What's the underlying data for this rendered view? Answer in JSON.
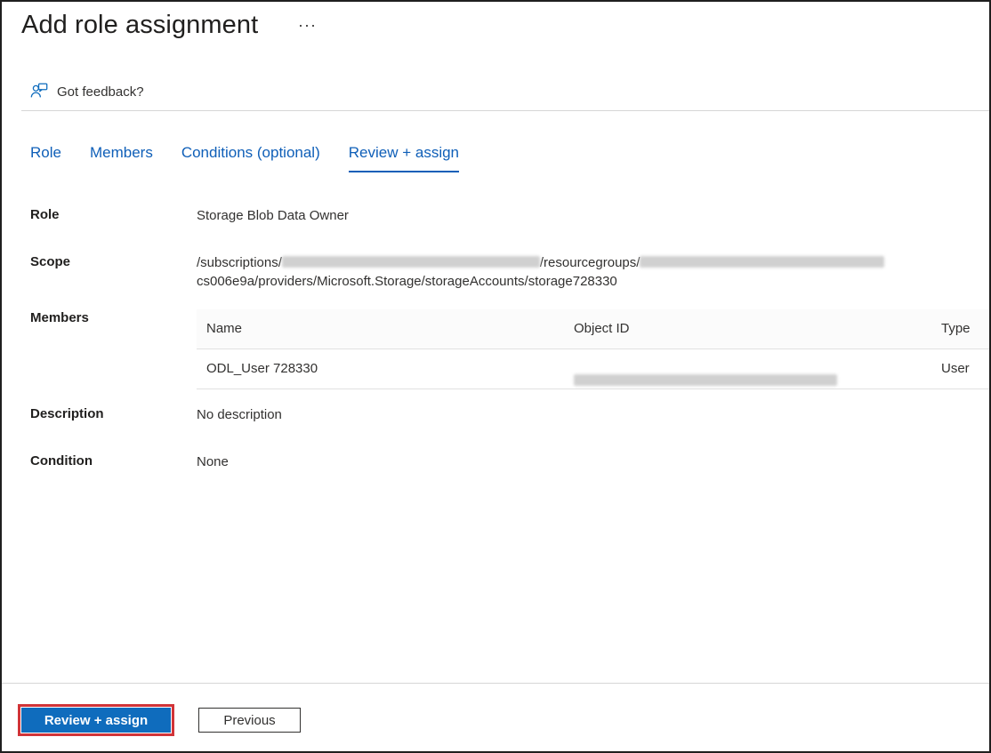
{
  "header": {
    "title": "Add role assignment",
    "more": "···"
  },
  "feedback": {
    "label": "Got feedback?"
  },
  "tabs": [
    {
      "label": "Role"
    },
    {
      "label": "Members"
    },
    {
      "label": "Conditions (optional)"
    },
    {
      "label": "Review + assign",
      "active": true
    }
  ],
  "details": {
    "role_label": "Role",
    "role_value": "Storage Blob Data Owner",
    "scope_label": "Scope",
    "scope_prefix": "/subscriptions/",
    "scope_mid": "/resourcegroups/",
    "scope_line2": "cs006e9a/providers/Microsoft.Storage/storageAccounts/storage728330",
    "members_label": "Members",
    "description_label": "Description",
    "description_value": "No description",
    "condition_label": "Condition",
    "condition_value": "None"
  },
  "members_table": {
    "columns": [
      "Name",
      "Object ID",
      "Type"
    ],
    "rows": [
      {
        "name": "ODL_User 728330",
        "type": "User"
      }
    ]
  },
  "footer": {
    "primary_label": "Review + assign",
    "secondary_label": "Previous"
  },
  "colors": {
    "accent": "#0f6cbd",
    "highlight": "#d13438"
  }
}
